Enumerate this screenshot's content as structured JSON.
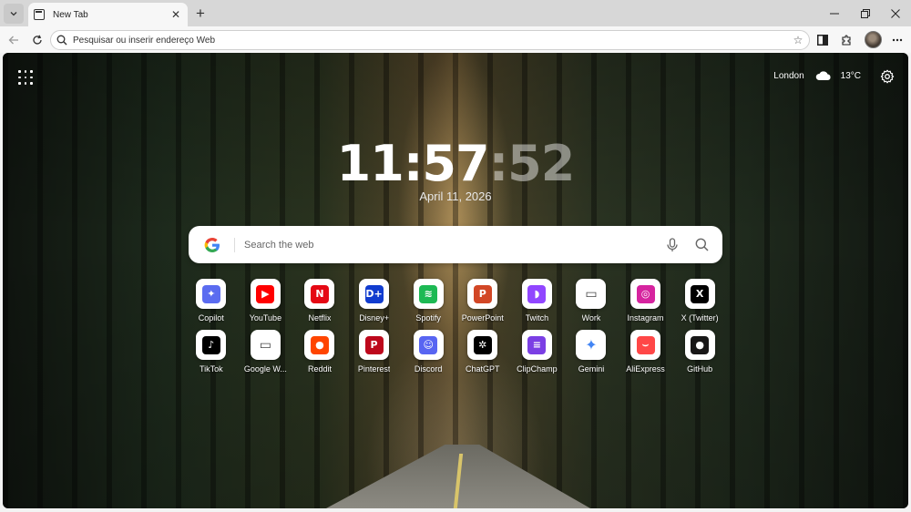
{
  "tab": {
    "title": "New Tab"
  },
  "omnibox": {
    "placeholder": "Pesquisar ou inserir endereço Web"
  },
  "weather": {
    "city": "London",
    "temperature": "13°C"
  },
  "clock": {
    "hm": "11:57",
    "sec": ":52"
  },
  "date": "April 11, 2026",
  "search": {
    "placeholder": "Search the web"
  },
  "shortcuts": [
    {
      "label": "Copilot",
      "icon": "copilot-icon",
      "color": "#5b6cf0"
    },
    {
      "label": "YouTube",
      "icon": "youtube-icon",
      "color": "#ff0000"
    },
    {
      "label": "Netflix",
      "icon": "netflix-icon",
      "color": "#e50914"
    },
    {
      "label": "Disney+",
      "icon": "disney-plus-icon",
      "color": "#113ccf"
    },
    {
      "label": "Spotify",
      "icon": "spotify-icon",
      "color": "#1db954"
    },
    {
      "label": "PowerPoint",
      "icon": "powerpoint-icon",
      "color": "#d24726"
    },
    {
      "label": "Twitch",
      "icon": "twitch-icon",
      "color": "#9146ff"
    },
    {
      "label": "Work",
      "icon": "folder-icon",
      "color": "#444444"
    },
    {
      "label": "Instagram",
      "icon": "instagram-icon",
      "color": "#d6249f"
    },
    {
      "label": "X (Twitter)",
      "icon": "x-twitter-icon",
      "color": "#000000"
    },
    {
      "label": "TikTok",
      "icon": "tiktok-icon",
      "color": "#000000"
    },
    {
      "label": "Google W...",
      "icon": "folder-icon",
      "color": "#444444"
    },
    {
      "label": "Reddit",
      "icon": "reddit-icon",
      "color": "#ff4500"
    },
    {
      "label": "Pinterest",
      "icon": "pinterest-icon",
      "color": "#bd081c"
    },
    {
      "label": "Discord",
      "icon": "discord-icon",
      "color": "#5865f2"
    },
    {
      "label": "ChatGPT",
      "icon": "chatgpt-icon",
      "color": "#000000"
    },
    {
      "label": "ClipChamp",
      "icon": "clipchamp-icon",
      "color": "#7b3fe4"
    },
    {
      "label": "Gemini",
      "icon": "gemini-icon",
      "color": "#4285f4"
    },
    {
      "label": "AliExpress",
      "icon": "aliexpress-icon",
      "color": "#ff4747"
    },
    {
      "label": "GitHub",
      "icon": "github-icon",
      "color": "#181717"
    }
  ]
}
